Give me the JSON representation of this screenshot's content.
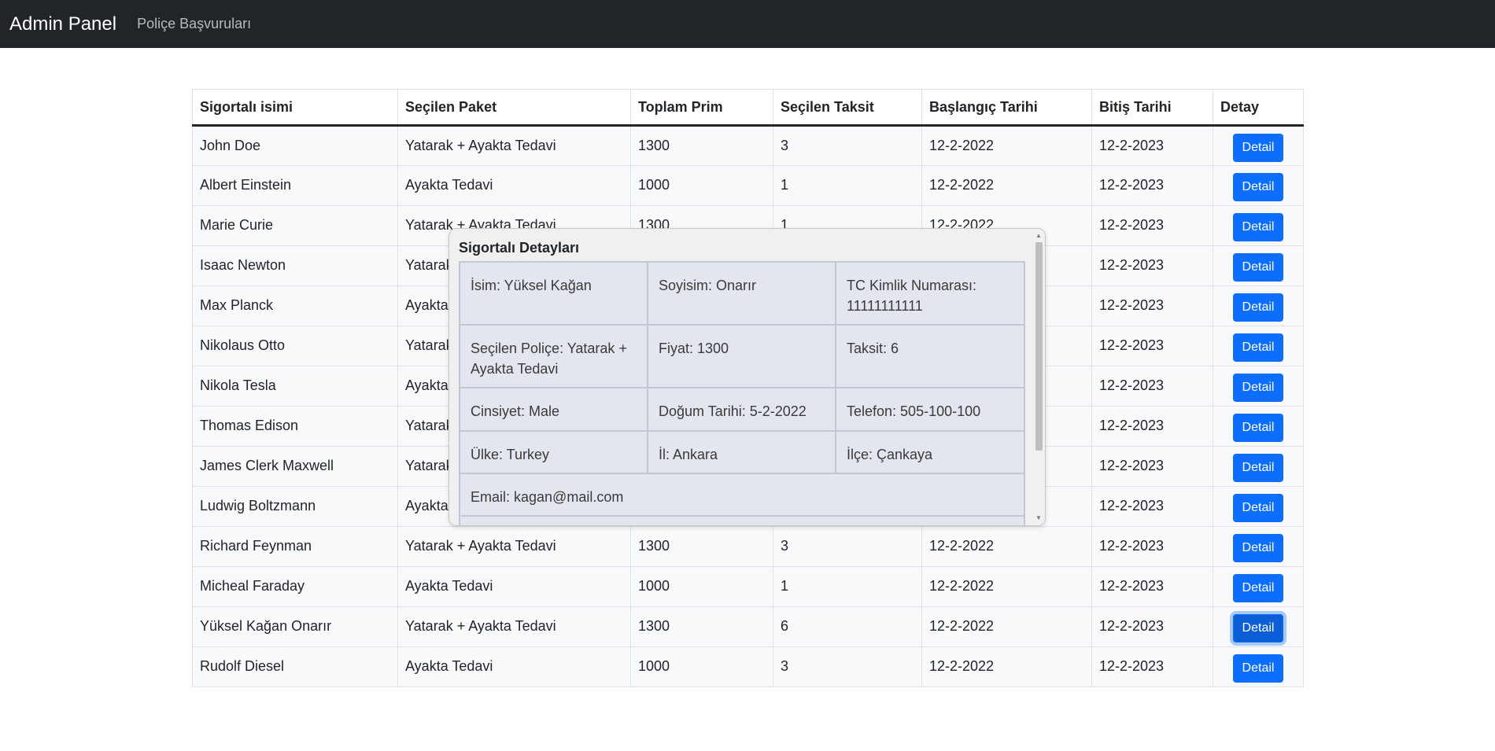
{
  "navbar": {
    "brand": "Admin Panel",
    "link": "Poliçe Başvuruları"
  },
  "table": {
    "headers": [
      "Sigortalı isimi",
      "Seçilen Paket",
      "Toplam Prim",
      "Seçilen Taksit",
      "Başlangıç Tarihi",
      "Bitiş Tarihi",
      "Detay"
    ],
    "button_label": "Detail",
    "rows": [
      [
        "John Doe",
        "Yatarak + Ayakta Tedavi",
        "1300",
        "3",
        "12-2-2022",
        "12-2-2023"
      ],
      [
        "Albert Einstein",
        "Ayakta Tedavi",
        "1000",
        "1",
        "12-2-2022",
        "12-2-2023"
      ],
      [
        "Marie Curie",
        "Yatarak + Ayakta Tedavi",
        "1300",
        "1",
        "12-2-2022",
        "12-2-2023"
      ],
      [
        "Isaac Newton",
        "Yatarak",
        "",
        "",
        "",
        "12-2-2023"
      ],
      [
        "Max Planck",
        "Ayakta",
        "",
        "",
        "",
        "12-2-2023"
      ],
      [
        "Nikolaus Otto",
        "Yatarak",
        "",
        "",
        "",
        "12-2-2023"
      ],
      [
        "Nikola Tesla",
        "Ayakta",
        "",
        "",
        "",
        "12-2-2023"
      ],
      [
        "Thomas Edison",
        "Yatarak",
        "",
        "",
        "",
        "12-2-2023"
      ],
      [
        "James Clerk Maxwell",
        "Yatarak",
        "",
        "",
        "",
        "12-2-2023"
      ],
      [
        "Ludwig Boltzmann",
        "Ayakta",
        "",
        "",
        "",
        "12-2-2023"
      ],
      [
        "Richard Feynman",
        "Yatarak + Ayakta Tedavi",
        "1300",
        "3",
        "12-2-2022",
        "12-2-2023"
      ],
      [
        "Micheal Faraday",
        "Ayakta Tedavi",
        "1000",
        "1",
        "12-2-2022",
        "12-2-2023"
      ],
      [
        "Yüksel Kağan Onarır",
        "Yatarak + Ayakta Tedavi",
        "1300",
        "6",
        "12-2-2022",
        "12-2-2023"
      ],
      [
        "Rudolf Diesel",
        "Ayakta Tedavi",
        "1000",
        "3",
        "12-2-2022",
        "12-2-2023"
      ]
    ],
    "active_row_index": 12
  },
  "modal": {
    "title": "Sigortalı Detayları",
    "fields": {
      "isim": "İsim: Yüksel Kağan",
      "soyisim": "Soyisim: Onarır",
      "tc": "TC Kimlik Numarası: 11111111111",
      "police": "Seçilen Poliçe: Yatarak + Ayakta Tedavi",
      "fiyat": "Fiyat: 1300",
      "taksit": "Taksit: 6",
      "cinsiyet": "Cinsiyet: Male",
      "dogum": "Doğum Tarihi: 5-2-2022",
      "telefon": "Telefon: 505-100-100",
      "ulke": "Ülke: Turkey",
      "il": "İl: Ankara",
      "ilce": "İlçe: Çankaya",
      "email": "Email: kagan@mail.com"
    }
  }
}
